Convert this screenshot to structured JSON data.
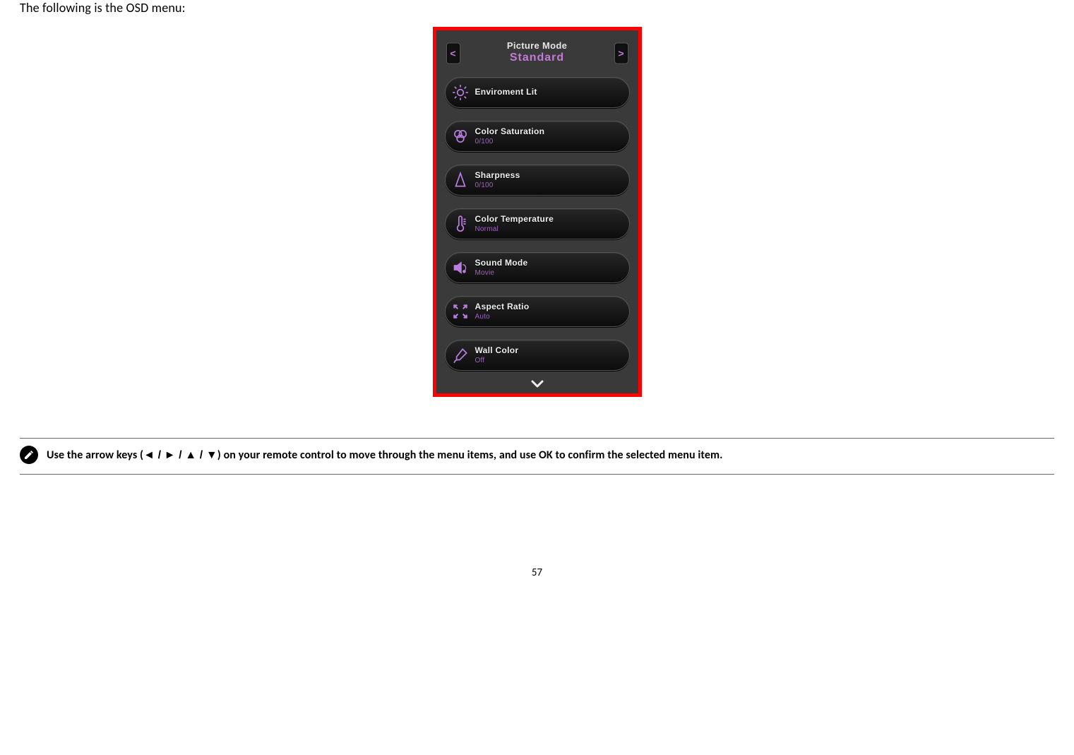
{
  "intro_text": "The following is the OSD menu:",
  "osd": {
    "header": {
      "title": "Picture Mode",
      "value": "Standard"
    },
    "left_arrow": "<",
    "right_arrow": ">",
    "items": [
      {
        "label": "Enviroment Lit",
        "value": ""
      },
      {
        "label": "Color Saturation",
        "value": "0/100"
      },
      {
        "label": "Sharpness",
        "value": "0/100"
      },
      {
        "label": "Color Temperature",
        "value": "Normal"
      },
      {
        "label": "Sound Mode",
        "value": "Movie"
      },
      {
        "label": "Aspect Ratio",
        "value": "Auto"
      },
      {
        "label": "Wall Color",
        "value": "Off"
      }
    ]
  },
  "note": {
    "prefix": "Use the arrow keys (",
    "keys": "◄ / ► / ▲ / ▼",
    "suffix": ") on your remote control to move through the menu items, and use OK to confirm the selected menu item."
  },
  "page_number": "57"
}
